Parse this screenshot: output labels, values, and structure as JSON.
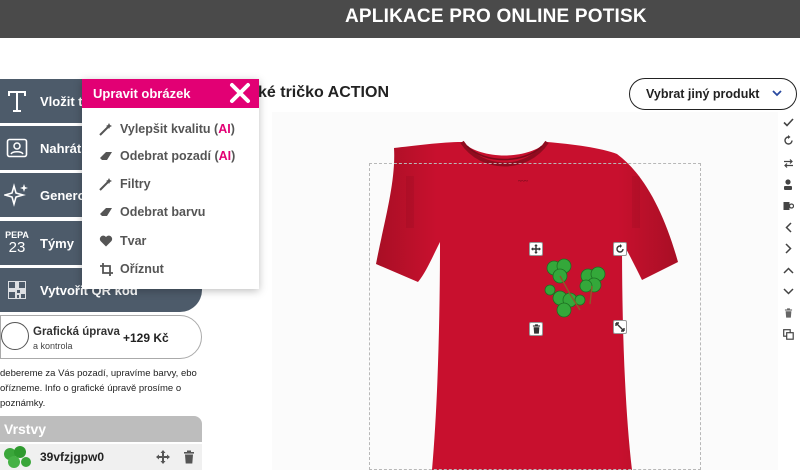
{
  "header": {
    "title": "APLIKACE PRO ONLINE POTISK"
  },
  "sidebar": {
    "buttons": [
      {
        "label": "Vložit t",
        "icon": "text-icon"
      },
      {
        "label": "Nahrát",
        "icon": "upload-image-icon"
      },
      {
        "label": "Generov",
        "icon": "sparkle-icon"
      },
      {
        "label": "Týmy",
        "icon": "team-number-icon",
        "icon_text_top": "PEPA",
        "icon_text_bottom": "23"
      },
      {
        "label": "Vytvořit QR kód",
        "icon": "qr-code-icon"
      }
    ],
    "graphic_edit": {
      "title": "Grafická úprava",
      "subtitle": "a kontrola",
      "price": "+129 Kč"
    },
    "note": "debereme za Vás pozadí, upravíme barvy, ebo ořízneme. Info o grafické úpravě prosíme o poznámky."
  },
  "layers": {
    "header": "Vrstvy",
    "items": [
      {
        "name": "39vfzjgpw0"
      }
    ]
  },
  "popup": {
    "title": "Upravit obrázek",
    "items": [
      {
        "label": "Vylepšit kvalitu (",
        "ai": "AI",
        "suffix": ")",
        "icon": "magic-wand-icon"
      },
      {
        "label": "Odebrat pozadí (",
        "ai": "AI",
        "suffix": ")",
        "icon": "eraser-icon"
      },
      {
        "label": "Filtry",
        "ai": "",
        "suffix": "",
        "icon": "magic-wand-icon"
      },
      {
        "label": "Odebrat barvu",
        "ai": "",
        "suffix": "",
        "icon": "eraser-icon"
      },
      {
        "label": "Tvar",
        "ai": "",
        "suffix": "",
        "icon": "heart-icon"
      },
      {
        "label": "Oříznut",
        "ai": "",
        "suffix": "",
        "icon": "crop-icon"
      }
    ]
  },
  "product": {
    "title": "ké tričko ACTION",
    "change_button": "Vybrat jiný produkt",
    "shirt_color": "#c8102e"
  },
  "colors": {
    "accent": "#e20074",
    "sidebar": "#4d5b6a",
    "topbar": "#4a4a4a"
  }
}
